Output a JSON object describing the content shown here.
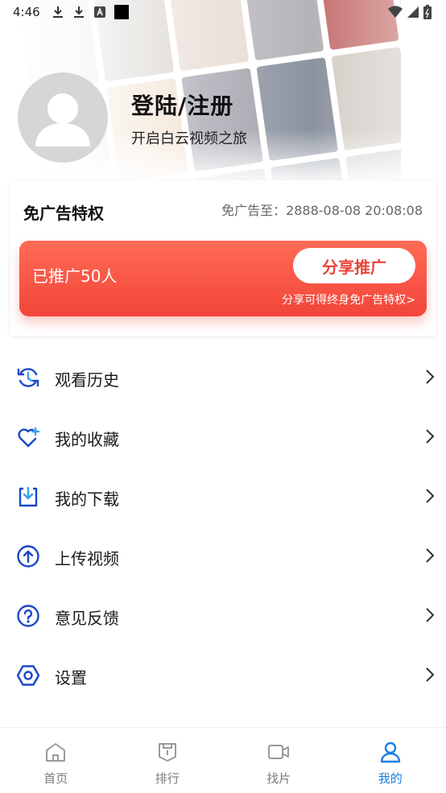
{
  "status_bar": {
    "time": "4:46",
    "icons": [
      "download-icon",
      "download-icon",
      "a-icon",
      "square-icon"
    ],
    "right_icons": [
      "wifi-icon",
      "signal-icon",
      "battery-icon"
    ]
  },
  "profile": {
    "title": "登陆/注册",
    "subtitle": "开启白云视频之旅"
  },
  "ad_free": {
    "title": "免广告特权",
    "expiry": "免广告至：2888-08-08 20:08:08",
    "promoted_count": "已推广50人",
    "share_button": "分享推广",
    "note": "分享可得终身免广告特权>"
  },
  "menu": [
    {
      "label": "观看历史",
      "icon": "history-icon"
    },
    {
      "label": "我的收藏",
      "icon": "heart-plus-icon"
    },
    {
      "label": "我的下载",
      "icon": "download-box-icon"
    },
    {
      "label": "上传视频",
      "icon": "upload-icon"
    },
    {
      "label": "意见反馈",
      "icon": "help-icon"
    },
    {
      "label": "设置",
      "icon": "settings-icon"
    }
  ],
  "tabs": [
    {
      "label": "首页",
      "icon": "home-icon",
      "active": false
    },
    {
      "label": "排行",
      "icon": "ranking-icon",
      "active": false
    },
    {
      "label": "找片",
      "icon": "video-camera-icon",
      "active": false
    },
    {
      "label": "我的",
      "icon": "user-icon",
      "active": true
    }
  ],
  "colors": {
    "accent_blue": "#1f7fe0",
    "menu_icon_blue": "#1a47c8",
    "promo_red": "#f2453a",
    "inactive_tab": "#7a7a7a"
  }
}
